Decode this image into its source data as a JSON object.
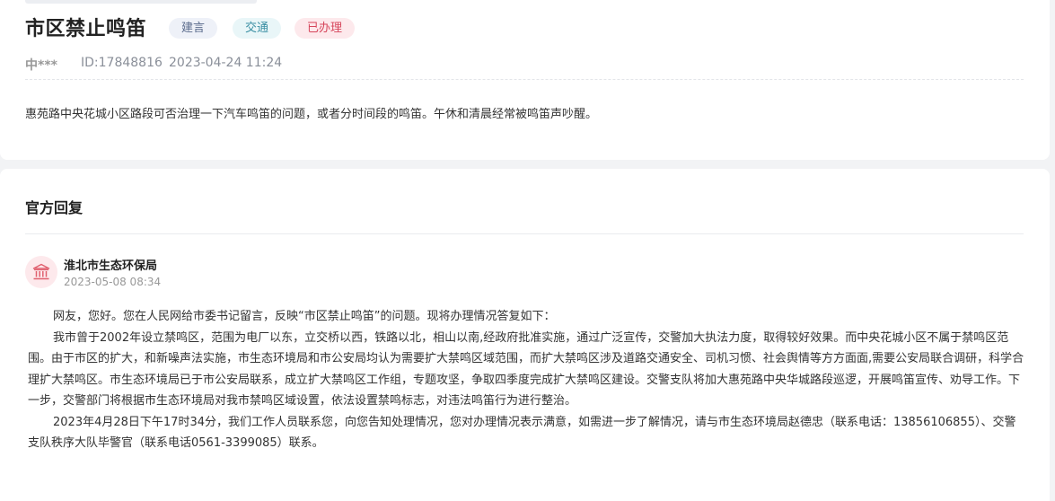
{
  "petition": {
    "title": "市区禁止鸣笛",
    "tags": [
      "建言",
      "交通",
      "已办理"
    ],
    "author": "中***",
    "id_label": "ID:17848816",
    "datetime": "2023-04-24 11:24",
    "content": "惠苑路中央花城小区路段可否治理一下汽车鸣笛的问题，或者分时间段的鸣笛。午休和清晨经常被鸣笛声吵醒。"
  },
  "reply": {
    "section_title": "官方回复",
    "avatar_icon": "government-building-icon",
    "department": "淮北市生态环保局",
    "date": "2023-05-08 08:34",
    "paragraphs": [
      "网友，您好。您在人民网给市委书记留言，反映“市区禁止鸣笛”的问题。现将办理情况答复如下：",
      "我市曾于2002年设立禁鸣区，范围为电厂以东，立交桥以西，铁路以北，相山以南,经政府批准实施，通过广泛宣传，交警加大执法力度，取得较好效果。而中央花城小区不属于禁鸣区范围。由于市区的扩大，和新噪声法实施，市生态环境局和市公安局均认为需要扩大禁鸣区域范围，而扩大禁鸣区涉及道路交通安全、司机习惯、社会舆情等方方面面,需要公安局联合调研，科学合理扩大禁鸣区。市生态环境局已于市公安局联系，成立扩大禁鸣区工作组，专题攻坚，争取四季度完成扩大禁鸣区建设。交警支队将加大惠苑路中央华城路段巡逻，开展鸣笛宣传、劝导工作。下一步，交警部门将根据市生态环境局对我市禁鸣区域设置，依法设置禁鸣标志，对违法鸣笛行为进行整治。",
      "2023年4月28日下午17时34分，我们工作人员联系您，向您告知处理情况，您对办理情况表示满意，如需进一步了解情况，请与市生态环境局赵德忠（联系电话：13856106855）、交警支队秩序大队毕警官（联系电话0561-3399085）联系。"
    ]
  },
  "colors": {
    "tag_suggest": "#5a6b8c",
    "tag_traffic": "#3a8fa3",
    "tag_done": "#d6455b"
  }
}
